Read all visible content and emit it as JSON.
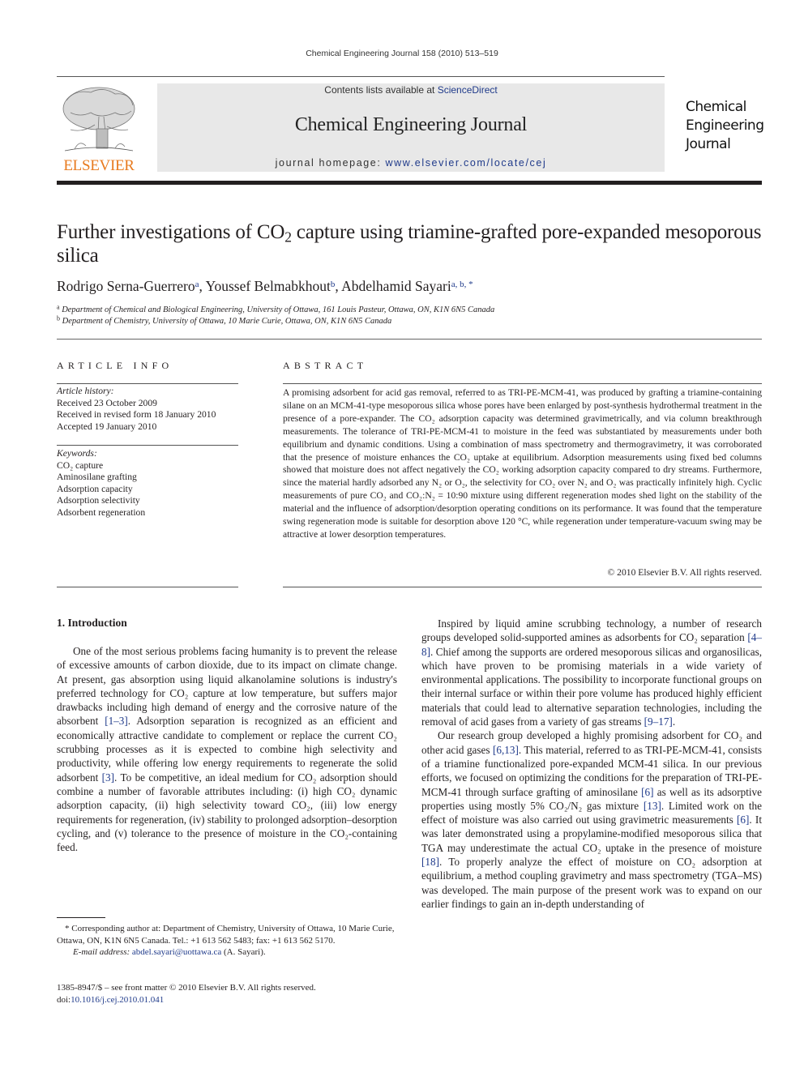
{
  "running_head": "Chemical Engineering Journal 158 (2010) 513–519",
  "header": {
    "publisher_logo_text": "ELSEVIER",
    "contents_prefix": "Contents lists available at ",
    "contents_link": "ScienceDirect",
    "journal_title": "Chemical Engineering Journal",
    "homepage_prefix": "journal homepage: ",
    "homepage_link": "www.elsevier.com/locate/cej",
    "journal_logo_lines": [
      "Chemical",
      "Engineering",
      "Journal"
    ],
    "colors": {
      "band": "#e8e8e8",
      "elsevier_orange": "#e87a1e",
      "link_blue": "#1f3a8a"
    }
  },
  "article": {
    "title_pre": "Further investigations of CO",
    "title_sub": "2",
    "title_post": " capture using triamine-grafted pore-expanded mesoporous silica",
    "authors": [
      {
        "name": "Rodrigo Serna-Guerrero",
        "marks": "a"
      },
      {
        "name": "Youssef Belmabkhout",
        "marks": "b"
      },
      {
        "name": "Abdelhamid Sayari",
        "marks": "a, b, *"
      }
    ],
    "affiliations": [
      {
        "mark": "a",
        "text": "Department of Chemical and Biological Engineering, University of Ottawa, 161 Louis Pasteur, Ottawa, ON, K1N 6N5 Canada"
      },
      {
        "mark": "b",
        "text": "Department of Chemistry, University of Ottawa, 10 Marie Curie, Ottawa, ON, K1N 6N5 Canada"
      }
    ]
  },
  "article_info": {
    "heading": "ARTICLE INFO",
    "history_label": "Article history:",
    "history": [
      "Received 23 October 2009",
      "Received in revised form 18 January 2010",
      "Accepted 19 January 2010"
    ],
    "keywords_label": "Keywords:",
    "keywords": [
      "CO₂ capture",
      "Aminosilane grafting",
      "Adsorption capacity",
      "Adsorption selectivity",
      "Adsorbent regeneration"
    ]
  },
  "abstract": {
    "heading": "ABSTRACT",
    "text": "A promising adsorbent for acid gas removal, referred to as TRI-PE-MCM-41, was produced by grafting a triamine-containing silane on an MCM-41-type mesoporous silica whose pores have been enlarged by post-synthesis hydrothermal treatment in the presence of a pore-expander. The CO₂ adsorption capacity was determined gravimetrically, and via column breakthrough measurements. The tolerance of TRI-PE-MCM-41 to moisture in the feed was substantiated by measurements under both equilibrium and dynamic conditions. Using a combination of mass spectrometry and thermogravimetry, it was corroborated that the presence of moisture enhances the CO₂ uptake at equilibrium. Adsorption measurements using fixed bed columns showed that moisture does not affect negatively the CO₂ working adsorption capacity compared to dry streams. Furthermore, since the material hardly adsorbed any N₂ or O₂, the selectivity for CO₂ over N₂ and O₂ was practically infinitely high. Cyclic measurements of pure CO₂ and CO₂:N₂ = 10:90 mixture using different regeneration modes shed light on the stability of the material and the influence of adsorption/desorption operating conditions on its performance. It was found that the temperature swing regeneration mode is suitable for desorption above 120 °C, while regeneration under temperature-vacuum swing may be attractive at lower desorption temperatures.",
    "copyright": "© 2010 Elsevier B.V. All rights reserved."
  },
  "intro": {
    "heading": "1.  Introduction",
    "left_paragraphs": [
      [
        {
          "t": "One of the most serious problems facing humanity is to prevent the release of excessive amounts of carbon dioxide, due to its impact on climate change. At present, gas absorption using liquid alkanolamine solutions is industry's preferred technology for CO₂ capture at low temperature, but suffers major drawbacks including high demand of energy and the corrosive nature of the absorbent "
        },
        {
          "ref": "[1–3]"
        },
        {
          "t": ". Adsorption separation is recognized as an efficient and economically attractive candidate to complement or replace the current CO₂ scrubbing processes as it is expected to combine high selectivity and productivity, while offering low energy requirements to regenerate the solid adsorbent "
        },
        {
          "ref": "[3]"
        },
        {
          "t": ". To be competitive, an ideal medium for CO₂ adsorption should combine a number of favorable attributes including: (i) high CO₂ dynamic adsorption capacity, (ii) high selectivity toward CO₂, (iii) low energy requirements for regeneration, (iv) stability to prolonged adsorption–desorption cycling, and (v) tolerance to the presence of moisture in the CO₂-containing feed."
        }
      ]
    ],
    "right_paragraphs": [
      [
        {
          "t": "Inspired by liquid amine scrubbing technology, a number of research groups developed solid-supported amines as adsorbents for CO₂ separation "
        },
        {
          "ref": "[4–8]"
        },
        {
          "t": ". Chief among the supports are ordered mesoporous silicas and organosilicas, which have proven to be promising materials in a wide variety of environmental applications. The possibility to incorporate functional groups on their internal surface or within their pore volume has produced highly efficient materials that could lead to alternative separation technologies, including the removal of acid gases from a variety of gas streams "
        },
        {
          "ref": "[9–17]"
        },
        {
          "t": "."
        }
      ],
      [
        {
          "t": "Our research group developed a highly promising adsorbent for CO₂ and other acid gases "
        },
        {
          "ref": "[6,13]"
        },
        {
          "t": ". This material, referred to as TRI-PE-MCM-41, consists of a triamine functionalized pore-expanded MCM-41 silica. In our previous efforts, we focused on optimizing the conditions for the preparation of TRI-PE-MCM-41 through surface grafting of aminosilane "
        },
        {
          "ref": "[6]"
        },
        {
          "t": " as well as its adsorptive properties using mostly 5% CO₂/N₂ gas mixture "
        },
        {
          "ref": "[13]"
        },
        {
          "t": ". Limited work on the effect of moisture was also carried out using gravimetric measurements "
        },
        {
          "ref": "[6]"
        },
        {
          "t": ". It was later demonstrated using a propylamine-modified mesoporous silica that TGA may underestimate the actual CO₂ uptake in the presence of moisture "
        },
        {
          "ref": "[18]"
        },
        {
          "t": ". To properly analyze the effect of moisture on CO₂ adsorption at equilibrium, a method coupling gravimetry and mass spectrometry (TGA–MS) was developed. The main purpose of the present work was to expand on our earlier findings to gain an in-depth understanding of"
        }
      ]
    ]
  },
  "footnote": {
    "corresponding": "* Corresponding author at: Department of Chemistry, University of Ottawa, 10 Marie Curie, Ottawa, ON, K1N 6N5 Canada. Tel.: +1 613 562 5483; fax: +1 613 562 5170.",
    "email_label": "E-mail address: ",
    "email": "abdel.sayari@uottawa.ca",
    "email_suffix": " (A. Sayari).",
    "issn_line": "1385-8947/$ – see front matter © 2010 Elsevier B.V. All rights reserved.",
    "doi_prefix": "doi:",
    "doi": "10.1016/j.cej.2010.01.041"
  }
}
